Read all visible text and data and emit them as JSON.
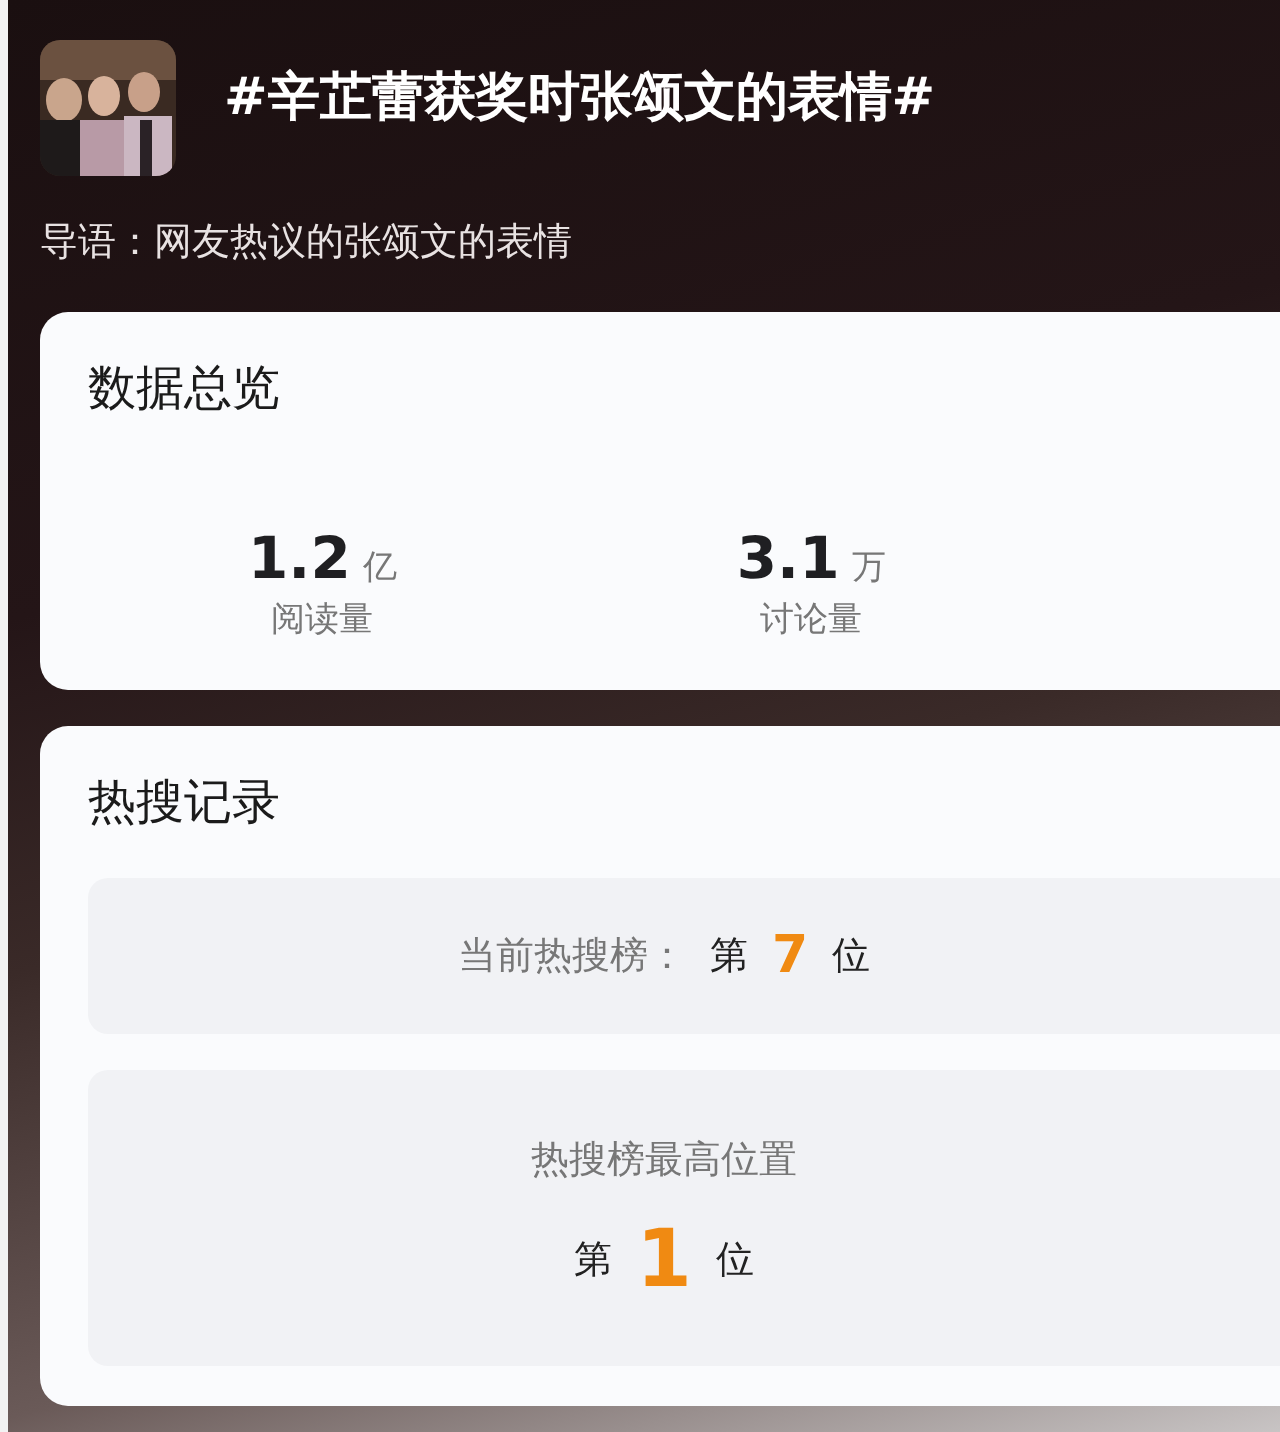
{
  "header": {
    "title": "#辛芷蕾获奖时张颂文的表情#",
    "intro": "导语：网友热议的张颂文的表情"
  },
  "overview": {
    "title": "数据总览",
    "stats": [
      {
        "value": "1.2",
        "unit": "亿",
        "label": "阅读量"
      },
      {
        "value": "3.1",
        "unit": "万",
        "label": "讨论量"
      }
    ]
  },
  "hot_search": {
    "title": "热搜记录",
    "entries": [
      {
        "kind": "inline",
        "label": "当前热搜榜：",
        "prefix": "第",
        "rank": "7",
        "suffix": "位"
      },
      {
        "kind": "stacked",
        "label": "热搜榜最高位置",
        "prefix": "第",
        "rank": "1",
        "suffix": "位"
      }
    ]
  }
}
